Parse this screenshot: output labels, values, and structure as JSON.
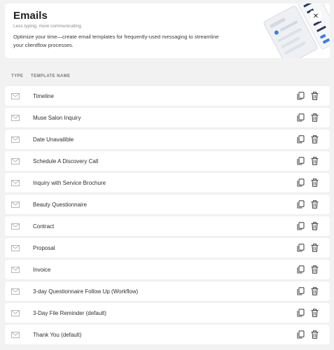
{
  "header": {
    "title": "Emails",
    "subtitle": "Less typing, more communicating",
    "description": "Optimize your time—create email templates for frequently-used messaging to streamline your clientflow processes."
  },
  "columns": {
    "type": "TYPE",
    "template_name": "TEMPLATE NAME"
  },
  "templates": [
    "Timeline",
    "Muse Salon Inquiry",
    "Date Unavailible",
    "Schedule A Discovery Call",
    "Inquiry with Service Brochure",
    "Beauty Questionnaire",
    "Contract",
    "Proposal",
    "Invoice",
    "3-day Questionnaire Follow Up (Workflow)",
    "3-Day File Reminder (default)",
    "Thank You (default)"
  ],
  "colors": {
    "accent": "#3d7cf0",
    "dark_line": "#2b3560",
    "background": "#f2f2f2"
  },
  "icons": {
    "type": "mail-icon",
    "duplicate": "copy-icon",
    "delete": "trash-icon",
    "close": "close-icon"
  }
}
